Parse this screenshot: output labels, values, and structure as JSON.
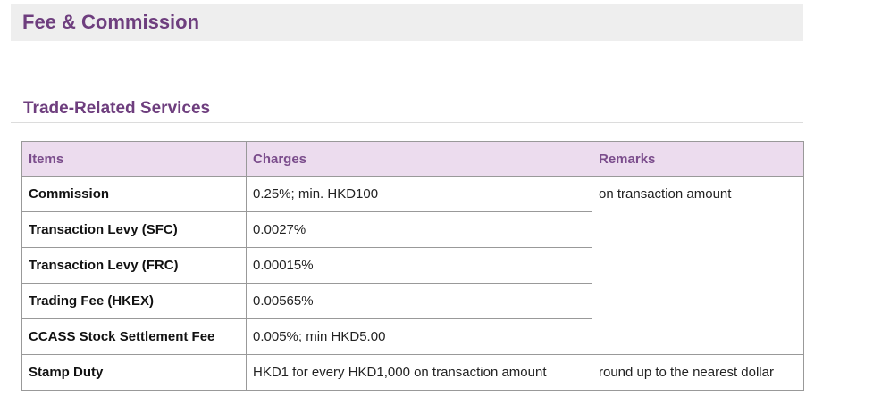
{
  "page": {
    "title": "Fee & Commission"
  },
  "section": {
    "title": "Trade-Related Services"
  },
  "table": {
    "headers": [
      "Items",
      "Charges",
      "Remarks"
    ],
    "rows": [
      {
        "item": "Commission",
        "charge": "0.25%; min. HKD100"
      },
      {
        "item": "Transaction Levy (SFC)",
        "charge": "0.0027%"
      },
      {
        "item": "Transaction Levy (FRC)",
        "charge": "0.00015%"
      },
      {
        "item": "Trading Fee (HKEX)",
        "charge": "0.00565%"
      },
      {
        "item": "CCASS Stock Settlement Fee",
        "charge": "0.005%; min HKD5.00"
      },
      {
        "item": "Stamp Duty",
        "charge": "HKD1 for every HKD1,000 on transaction amount"
      }
    ],
    "remarks": {
      "shared": "on transaction amount",
      "stamp_duty": "round up to the nearest dollar"
    }
  },
  "colors": {
    "accent": "#6e3e7e",
    "header_bg": "#ecdcee",
    "title_bar_bg": "#eeeeee",
    "border": "#999999"
  }
}
